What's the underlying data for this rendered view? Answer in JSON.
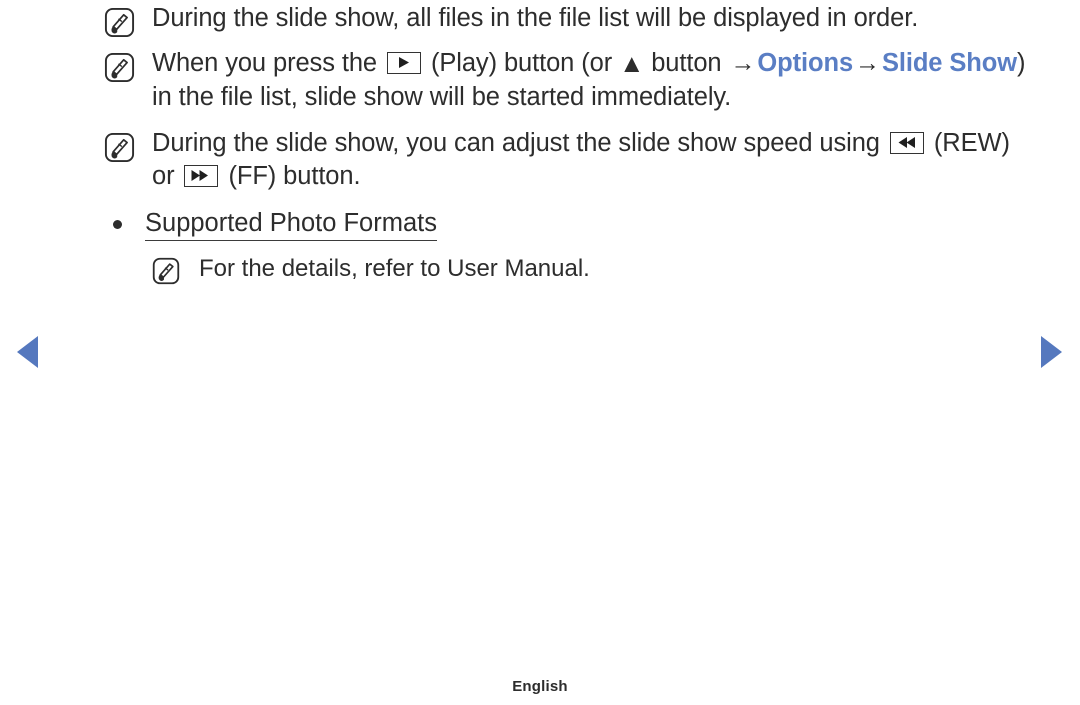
{
  "document": {
    "footer_label": "English"
  },
  "notes": [
    {
      "icon": "note-pen-icon",
      "segments": [
        {
          "type": "text",
          "value": "During the slide show, all files in the file list will be displayed in order."
        }
      ]
    },
    {
      "icon": "note-pen-icon",
      "segments": [
        {
          "type": "text",
          "value": "When you press the "
        },
        {
          "type": "key",
          "value": "play-button-icon"
        },
        {
          "type": "text",
          "value": " (Play) button (or "
        },
        {
          "type": "glyph",
          "value": "▲"
        },
        {
          "type": "text",
          "value": " button "
        },
        {
          "type": "arrow",
          "value": "→"
        },
        {
          "type": "menu",
          "value": "Options"
        },
        {
          "type": "arrow",
          "value": "→"
        },
        {
          "type": "menu",
          "value": "Slide Show"
        },
        {
          "type": "text",
          "value": ") in the file list, slide show will be started immediately."
        }
      ]
    },
    {
      "icon": "note-pen-icon",
      "segments": [
        {
          "type": "text",
          "value": "During the slide show, you can adjust the slide show speed using "
        },
        {
          "type": "key",
          "value": "rewind-button-icon"
        },
        {
          "type": "text",
          "value": " (REW) or "
        },
        {
          "type": "key",
          "value": "fast-forward-button-icon"
        },
        {
          "type": "text",
          "value": " (FF) button."
        }
      ]
    }
  ],
  "section": {
    "bullet_title": "Supported Photo Formats",
    "sub_note": {
      "icon": "note-pen-icon",
      "text": "For the details, refer to User Manual."
    }
  },
  "navigation": {
    "prev_label": "previous-page",
    "next_label": "next-page"
  },
  "colors": {
    "menu_blue": "#5a7ec4",
    "nav_arrow_blue": "#5578be",
    "body_text": "#2d2d2d"
  },
  "labels": {
    "note_1_text": "During the slide show, all files in the file list will be displayed in order.",
    "note_2_part_a": "When you press the ",
    "note_2_part_b": " (Play) button (or ",
    "note_2_up_triangle": "▲",
    "note_2_part_c": " button ",
    "note_2_arrow_1": "→",
    "note_2_menu_options": "Options",
    "note_2_arrow_2": "→",
    "note_2_menu_slideshow": "Slide Show",
    "note_2_part_d": ") in the file list, slide show will be started immediately.",
    "note_3_part_a": "During the slide show, you can adjust the slide show speed using ",
    "note_3_part_b": " (REW) or ",
    "note_3_part_c": " (FF) button.",
    "bullet_title": "Supported Photo Formats",
    "sub_note_text": "For the details, refer to User Manual.",
    "footer": "English"
  }
}
